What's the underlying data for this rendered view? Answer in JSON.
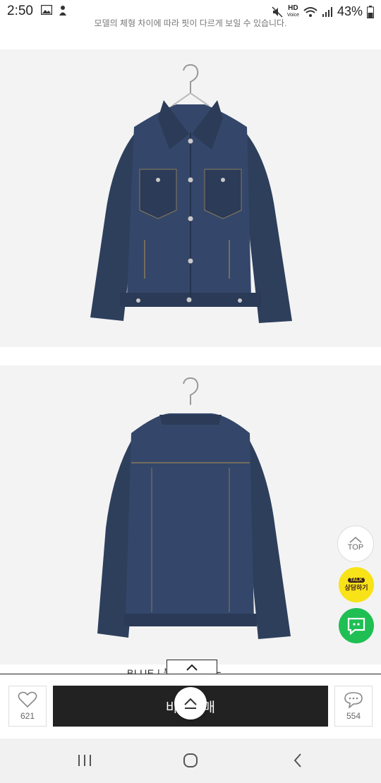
{
  "status": {
    "time": "2:50",
    "battery": "43%",
    "hd_label": "HD",
    "voice_label": "Voice"
  },
  "page": {
    "truncated_text": "모델의 체형 차이에 따라 핏이 다르게 보일 수 있습니다.",
    "caption": "BLUE | 블루 | ブルー"
  },
  "images": [
    {
      "alt": "Denim jacket front view"
    },
    {
      "alt": "Denim jacket back view"
    }
  ],
  "bottom_bar": {
    "like_count": "621",
    "buy_label": "바로구매",
    "comment_count": "554"
  },
  "floating": {
    "top_label": "TOP",
    "kakao_badge": "TALK",
    "kakao_label": "상담하기"
  },
  "colors": {
    "denim": "#2e3f5c",
    "buy_button": "#222222",
    "kakao": "#f7e317",
    "chat": "#1fbf54"
  }
}
